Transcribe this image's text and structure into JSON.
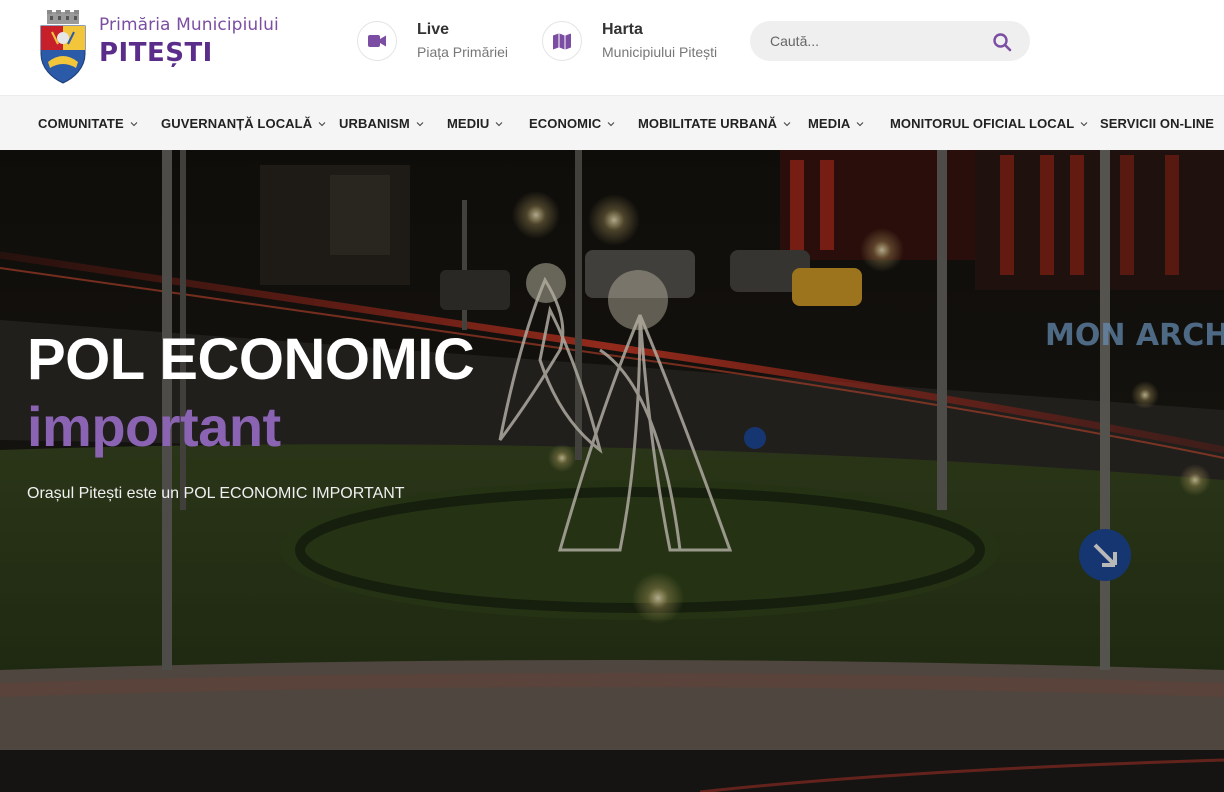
{
  "header": {
    "logo": {
      "line1": "Primăria Municipiului",
      "line2": "PITEȘTI"
    },
    "live": {
      "title": "Live",
      "subtitle": "Piața Primăriei",
      "icon": "video-camera-icon"
    },
    "map": {
      "title": "Harta",
      "subtitle": "Municipiului Pitești",
      "icon": "map-icon"
    },
    "search": {
      "placeholder": "Caută...",
      "icon": "search-icon"
    }
  },
  "nav": {
    "items": [
      {
        "label": "COMUNITATE",
        "has_dropdown": true
      },
      {
        "label": "GUVERNANȚĂ LOCALĂ",
        "has_dropdown": true
      },
      {
        "label": "URBANISM",
        "has_dropdown": true
      },
      {
        "label": "MEDIU",
        "has_dropdown": true
      },
      {
        "label": "ECONOMIC",
        "has_dropdown": true
      },
      {
        "label": "MOBILITATE URBANĂ",
        "has_dropdown": true
      },
      {
        "label": "MEDIA",
        "has_dropdown": true
      },
      {
        "label": "MONITORUL OFICIAL LOCAL",
        "has_dropdown": true
      },
      {
        "label": "SERVICII ON-LINE",
        "has_dropdown": false
      }
    ]
  },
  "hero": {
    "title": "POL ECONOMIC",
    "subtitle": "important",
    "description": "Orașul Pitești este un POL ECONOMIC IMPORTANT"
  },
  "colors": {
    "brand_purple": "#5b2d8a",
    "accent_purple": "#8a63b3",
    "nav_bg": "#f5f5f5",
    "search_bg": "#efefef"
  }
}
